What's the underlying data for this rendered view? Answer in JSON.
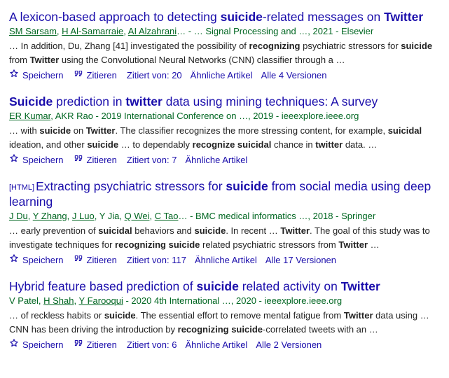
{
  "actions": {
    "save": "Speichern",
    "cite": "Zitieren",
    "related": "Ähnliche Artikel"
  },
  "results": [
    {
      "title_parts": [
        {
          "t": "A lexicon-based approach to detecting ",
          "b": false
        },
        {
          "t": "suicide",
          "b": true
        },
        {
          "t": "-related messages on ",
          "b": false
        },
        {
          "t": "Twitter",
          "b": true
        }
      ],
      "authors": [
        {
          "name": "SM Sarsam",
          "link": true
        },
        {
          "name": ", ",
          "link": false
        },
        {
          "name": "H Al-Samarraie",
          "link": true
        },
        {
          "name": ", ",
          "link": false
        },
        {
          "name": "AI Alzahrani",
          "link": true
        },
        {
          "name": "… - … Signal Processing and …, 2021 - Elsevier",
          "link": false
        }
      ],
      "snippet_parts": [
        {
          "t": "… In addition, Du, Zhang [41] investigated the possibility of ",
          "b": false
        },
        {
          "t": "recognizing",
          "b": true
        },
        {
          "t": " psychiatric stressors for ",
          "b": false
        },
        {
          "t": "suicide",
          "b": true
        },
        {
          "t": " from ",
          "b": false
        },
        {
          "t": "Twitter",
          "b": true
        },
        {
          "t": " using the Convolutional Neural Networks (CNN) classifier through a …",
          "b": false
        }
      ],
      "cited_by": "Zitiert von: 20",
      "versions": "Alle 4 Versionen"
    },
    {
      "title_parts": [
        {
          "t": "Suicide",
          "b": true
        },
        {
          "t": " prediction in ",
          "b": false
        },
        {
          "t": "twitter",
          "b": true
        },
        {
          "t": " data using mining techniques: A survey",
          "b": false
        }
      ],
      "authors": [
        {
          "name": "ER Kumar",
          "link": true
        },
        {
          "name": ", AKR Rao - 2019 International Conference on …, 2019 - ieeexplore.ieee.org",
          "link": false
        }
      ],
      "snippet_parts": [
        {
          "t": "… with ",
          "b": false
        },
        {
          "t": "suicide",
          "b": true
        },
        {
          "t": " on ",
          "b": false
        },
        {
          "t": "Twitter",
          "b": true
        },
        {
          "t": ". The classifier recognizes the more stressing content, for example, ",
          "b": false
        },
        {
          "t": "suicidal",
          "b": true
        },
        {
          "t": " ideation, and other ",
          "b": false
        },
        {
          "t": "suicide",
          "b": true
        },
        {
          "t": " … to dependably ",
          "b": false
        },
        {
          "t": "recognize suicidal",
          "b": true
        },
        {
          "t": " chance in ",
          "b": false
        },
        {
          "t": "twitter",
          "b": true
        },
        {
          "t": " data. …",
          "b": false
        }
      ],
      "cited_by": "Zitiert von: 7",
      "versions": ""
    },
    {
      "tag": "[HTML]",
      "title_parts": [
        {
          "t": "Extracting psychiatric stressors for ",
          "b": false
        },
        {
          "t": "suicide",
          "b": true
        },
        {
          "t": " from social media using deep learning",
          "b": false
        }
      ],
      "authors": [
        {
          "name": "J Du",
          "link": true
        },
        {
          "name": ", ",
          "link": false
        },
        {
          "name": "Y Zhang",
          "link": true
        },
        {
          "name": ", ",
          "link": false
        },
        {
          "name": "J Luo",
          "link": true
        },
        {
          "name": ", Y Jia, ",
          "link": false
        },
        {
          "name": "Q Wei",
          "link": true
        },
        {
          "name": ", ",
          "link": false
        },
        {
          "name": "C Tao",
          "link": true
        },
        {
          "name": "… - BMC medical informatics …, 2018 - Springer",
          "link": false
        }
      ],
      "snippet_parts": [
        {
          "t": "… early prevention of ",
          "b": false
        },
        {
          "t": "suicidal",
          "b": true
        },
        {
          "t": " behaviors and ",
          "b": false
        },
        {
          "t": "suicide",
          "b": true
        },
        {
          "t": ". In recent … ",
          "b": false
        },
        {
          "t": "Twitter",
          "b": true
        },
        {
          "t": ". The goal of this study was to investigate techniques for ",
          "b": false
        },
        {
          "t": "recognizing suicide",
          "b": true
        },
        {
          "t": " related psychiatric stressors from ",
          "b": false
        },
        {
          "t": "Twitter",
          "b": true
        },
        {
          "t": " …",
          "b": false
        }
      ],
      "cited_by": "Zitiert von: 117",
      "versions": "Alle 17 Versionen"
    },
    {
      "title_parts": [
        {
          "t": "Hybrid feature based prediction of ",
          "b": false
        },
        {
          "t": "suicide",
          "b": true
        },
        {
          "t": " related activity on ",
          "b": false
        },
        {
          "t": "Twitter",
          "b": true
        }
      ],
      "authors": [
        {
          "name": "V Patel, ",
          "link": false
        },
        {
          "name": "H Shah",
          "link": true
        },
        {
          "name": ", ",
          "link": false
        },
        {
          "name": "Y Farooqui",
          "link": true
        },
        {
          "name": " - 2020 4th International …, 2020 - ieeexplore.ieee.org",
          "link": false
        }
      ],
      "snippet_parts": [
        {
          "t": "… of reckless habits or ",
          "b": false
        },
        {
          "t": "suicide",
          "b": true
        },
        {
          "t": ". The essential effort to remove mental fatigue from ",
          "b": false
        },
        {
          "t": "Twitter",
          "b": true
        },
        {
          "t": " data using … CNN has been driving the introduction by ",
          "b": false
        },
        {
          "t": "recognizing suicide",
          "b": true
        },
        {
          "t": "-correlated tweets with an …",
          "b": false
        }
      ],
      "cited_by": "Zitiert von: 6",
      "versions": "Alle 2 Versionen"
    }
  ]
}
